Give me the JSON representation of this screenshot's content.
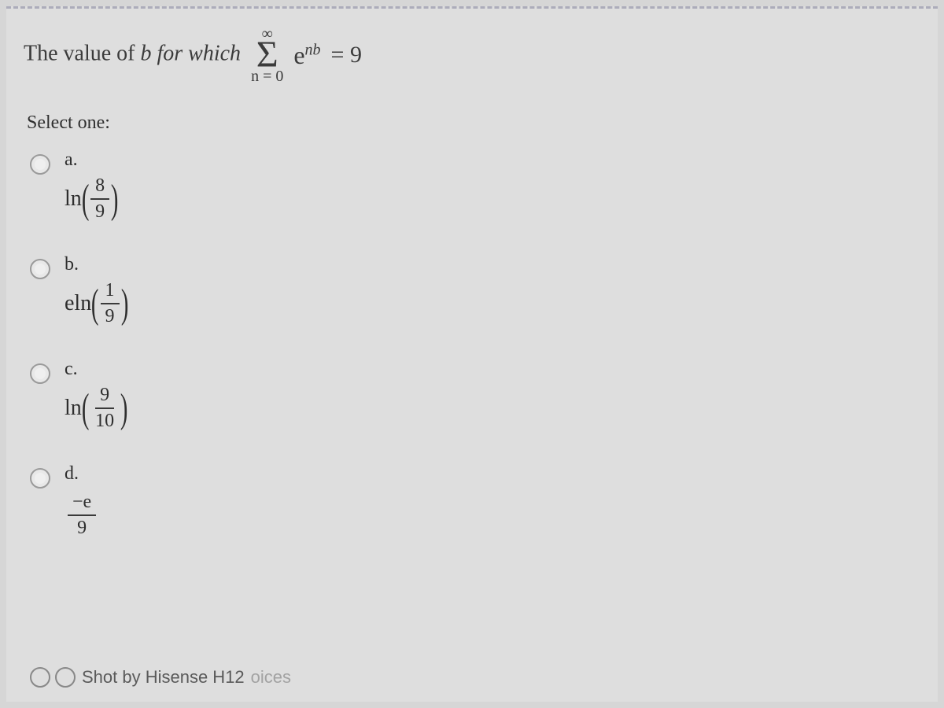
{
  "question": {
    "prefix": "The value of ",
    "b": "b",
    "for_which": "for which",
    "sigma": {
      "upper": "∞",
      "symbol": "Σ",
      "lower": "n = 0"
    },
    "term_base": "e",
    "term_exp": "nb",
    "equals": " = 9"
  },
  "select_label": "Select one:",
  "options": {
    "a": {
      "letter": "a.",
      "fn": "ln",
      "num": "8",
      "den": "9"
    },
    "b": {
      "letter": "b.",
      "fn": "eln",
      "num": "1",
      "den": "9"
    },
    "c": {
      "letter": "c.",
      "fn": "ln",
      "num": "9",
      "den": "10"
    },
    "d": {
      "letter": "d.",
      "num": "−e",
      "den": "9"
    }
  },
  "watermark": {
    "brand_dark": "Shot by Hisense H12",
    "tail": "oices"
  }
}
